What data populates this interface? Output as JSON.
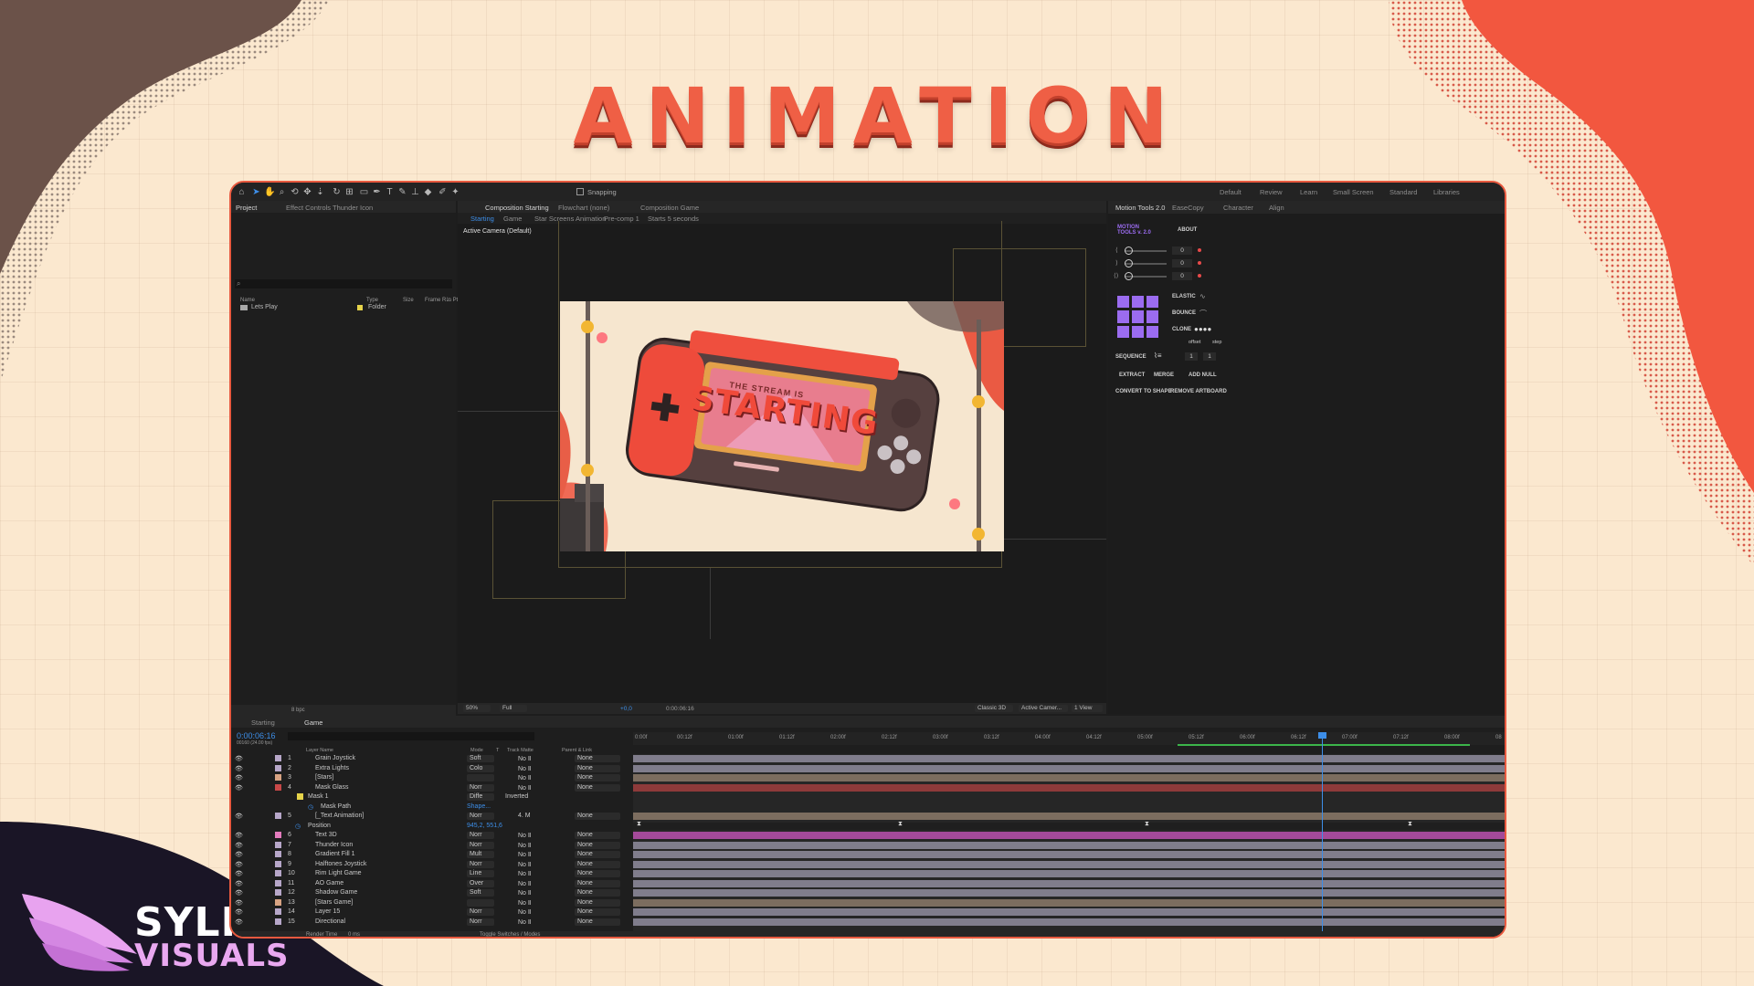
{
  "page": {
    "title": "ANIMATION",
    "brand_top": "SYLPH",
    "brand_bottom": "VISUALS"
  },
  "colors": {
    "accent": "#e8593f",
    "blue": "#3d8ee8",
    "purple": "#9b6cf0"
  },
  "toolbar": {
    "snapping_label": "Snapping",
    "workspaces": [
      "Default",
      "Review",
      "Learn",
      "Small Screen",
      "Standard",
      "Libraries"
    ]
  },
  "project_panel": {
    "tab_project": "Project",
    "tab_effect_controls": "Effect Controls Thunder Icon",
    "search_placeholder": "⌕",
    "columns": [
      "Name",
      "Type",
      "Size",
      "Frame R...",
      "In Pt"
    ],
    "items": [
      {
        "name": "Lets Play",
        "type": "Folder"
      }
    ],
    "bpc": "8 bpc"
  },
  "comp_panel": {
    "tab_comp": "Composition Starting",
    "tab_flowchart": "Flowchart (none)",
    "tab_comp_game": "Composition Game",
    "breadcrumbs": [
      "Starting",
      "Game",
      "Star Screens Animation",
      "Pre-comp 1",
      "Starts 5 seconds"
    ],
    "camera_label": "Active Camera (Default)",
    "zoom": "50%",
    "resolution": "Full",
    "exposure": "+0,0",
    "timecode": "0:00:06:16",
    "renderer": "Classic 3D",
    "camera": "Active Camer...",
    "views": "1 View",
    "art_text_top": "THE STREAM IS",
    "art_text_main": "STARTING"
  },
  "motion_tools": {
    "tabs": [
      "Motion Tools 2.0",
      "EaseCopy",
      "Character",
      "Align"
    ],
    "logo_line1": "MOTION",
    "logo_line2": "TOOLS v. 2.0",
    "about": "ABOUT",
    "sliders": [
      {
        "label": "⟨",
        "value": "0"
      },
      {
        "label": "⟩",
        "value": "0"
      },
      {
        "label": "⟨⟩",
        "value": "0"
      }
    ],
    "elastic": "ELASTIC",
    "bounce": "BOUNCE",
    "clone": "CLONE",
    "offset": "offset",
    "step": "step",
    "sequence": "SEQUENCE",
    "seq_a": "1",
    "seq_b": "1",
    "extract": "EXTRACT",
    "merge": "MERGE",
    "add_null": "ADD NULL",
    "convert": "CONVERT TO SHAPE",
    "remove_artboard": "REMOVE ARTBOARD"
  },
  "timeline": {
    "tabs": [
      "Starting",
      "Game"
    ],
    "timecode": "0:00:06:16",
    "fps": "00160 (24.00 fps)",
    "columns": {
      "layer_name": "Layer Name",
      "mode": "Mode",
      "t": "T",
      "track_matte": "Track Matte",
      "parent": "Parent & Link"
    },
    "ruler": [
      "0:00f",
      "00:12f",
      "01:00f",
      "01:12f",
      "02:00f",
      "02:12f",
      "03:00f",
      "03:12f",
      "04:00f",
      "04:12f",
      "05:00f",
      "05:12f",
      "06:00f",
      "06:12f",
      "07:00f",
      "07:12f",
      "08:00f",
      "08"
    ],
    "layers": [
      {
        "num": "1",
        "name": "Grain Joystick",
        "mode": "Soft",
        "matte": "No Ⅱ",
        "parent": "None"
      },
      {
        "num": "2",
        "name": "Extra Lights",
        "mode": "Colo",
        "matte": "No Ⅱ",
        "parent": "None"
      },
      {
        "num": "3",
        "name": "[Stars]",
        "mode": "",
        "matte": "No Ⅱ",
        "parent": "None"
      },
      {
        "num": "4",
        "name": "Mask Glass",
        "mode": "Norr",
        "matte": "No Ⅱ",
        "parent": "None"
      },
      {
        "num": "",
        "name": "Mask 1",
        "mode": "Diffe",
        "matte": "Inverted",
        "parent": ""
      },
      {
        "num": "",
        "name": "Mask Path",
        "mode": "Shape...",
        "matte": "",
        "parent": ""
      },
      {
        "num": "5",
        "name": "[_Text Animation]",
        "mode": "Norr",
        "matte": "4. M",
        "parent": "None"
      },
      {
        "num": "",
        "name": "Position",
        "mode": "945,2, 551,6",
        "matte": "",
        "parent": ""
      },
      {
        "num": "6",
        "name": "Text 3D",
        "mode": "Norr",
        "matte": "No Ⅱ",
        "parent": "None"
      },
      {
        "num": "7",
        "name": "Thunder Icon",
        "mode": "Norr",
        "matte": "No Ⅱ",
        "parent": "None"
      },
      {
        "num": "8",
        "name": "Gradient Fill 1",
        "mode": "Mult",
        "matte": "No Ⅱ",
        "parent": "None"
      },
      {
        "num": "9",
        "name": "Halftones Joystick",
        "mode": "Norr",
        "matte": "No Ⅱ",
        "parent": "None"
      },
      {
        "num": "10",
        "name": "Rim Light Game",
        "mode": "Line",
        "matte": "No Ⅱ",
        "parent": "None"
      },
      {
        "num": "11",
        "name": "AO Game",
        "mode": "Over",
        "matte": "No Ⅱ",
        "parent": "None"
      },
      {
        "num": "12",
        "name": "Shadow Game",
        "mode": "Soft",
        "matte": "No Ⅱ",
        "parent": "None"
      },
      {
        "num": "13",
        "name": "[Stars Game]",
        "mode": "",
        "matte": "No Ⅱ",
        "parent": "None"
      },
      {
        "num": "14",
        "name": "Layer 15",
        "mode": "Norr",
        "matte": "No Ⅱ",
        "parent": "None"
      },
      {
        "num": "15",
        "name": "Directional",
        "mode": "Norr",
        "matte": "No Ⅱ",
        "parent": "None"
      }
    ],
    "render_time": "Render Time",
    "render_ms": "0 ms",
    "toggle": "Toggle Switches / Modes"
  }
}
